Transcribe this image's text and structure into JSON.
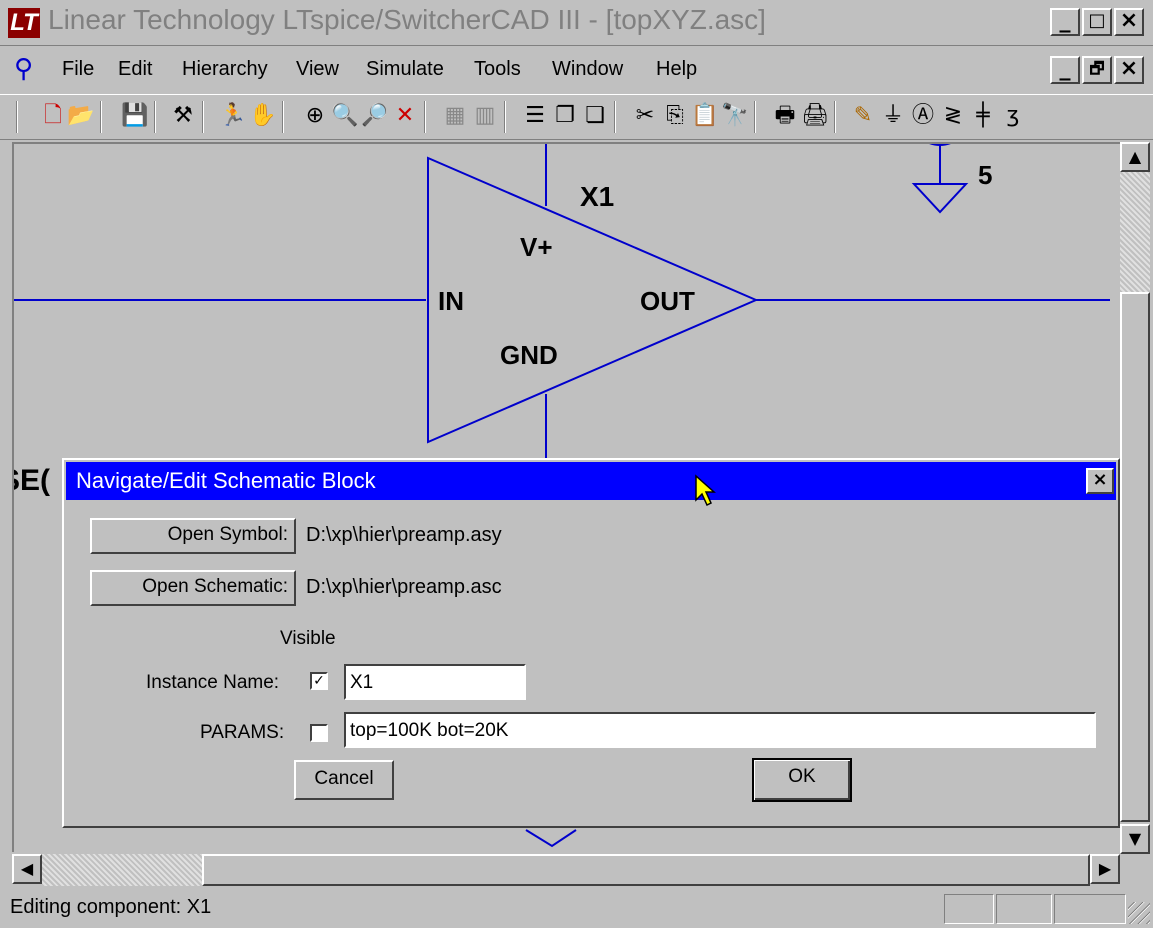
{
  "window": {
    "title": "Linear Technology LTspice/SwitcherCAD III - [topXYZ.asc]",
    "logo_text": "LT",
    "minimize_glyph": "_",
    "maximize_glyph": "□",
    "restore_glyph": "🗗",
    "close_glyph": "×"
  },
  "menu": {
    "items": [
      "File",
      "Edit",
      "Hierarchy",
      "View",
      "Simulate",
      "Tools",
      "Window",
      "Help"
    ]
  },
  "toolbar": {
    "icons": [
      "new-schematic-icon",
      "open-icon",
      "save-icon",
      "control-panel-icon",
      "run-icon",
      "pan-icon",
      "zoom-area-icon",
      "zoom-in-icon",
      "zoom-out-icon",
      "zoom-fit-icon",
      "autorange-icon",
      "rotate-icon",
      "tile-horizontal-icon",
      "cascade-icon",
      "close-all-icon",
      "cut-icon",
      "copy-icon",
      "paste-icon",
      "find-icon",
      "print-preview-icon",
      "print-icon",
      "draw-wire-icon",
      "ground-icon",
      "label-net-icon",
      "resistor-icon",
      "capacitor-icon",
      "inductor-icon"
    ]
  },
  "schematic": {
    "component_name": "X1",
    "pin_vplus": "V+",
    "pin_in": "IN",
    "pin_out": "OUT",
    "pin_gnd": "GND",
    "net_label": "5",
    "partial_text": "SE("
  },
  "dialog": {
    "title": "Navigate/Edit Schematic Block",
    "close_glyph": "×",
    "open_symbol_label": "Open Symbol:",
    "symbol_path": "D:\\xp\\hier\\preamp.asy",
    "open_schematic_label": "Open Schematic:",
    "schematic_path": "D:\\xp\\hier\\preamp.asc",
    "visible_header": "Visible",
    "instance_name_label": "Instance Name:",
    "instance_name_checked": true,
    "instance_name_value": "X1",
    "params_label": "PARAMS:",
    "params_checked": false,
    "params_value": "top=100K bot=20K",
    "cancel_label": "Cancel",
    "ok_label": "OK",
    "check_glyph": "✓"
  },
  "scroll": {
    "up": "▲",
    "down": "▼",
    "left": "◀",
    "right": "▶"
  },
  "statusbar": {
    "text": "Editing component: X1"
  },
  "colors": {
    "title_text_inactive": "#808080",
    "dialog_title_bg": "#0000ff",
    "wire": "#0000cc",
    "face": "#c0c0c0"
  }
}
